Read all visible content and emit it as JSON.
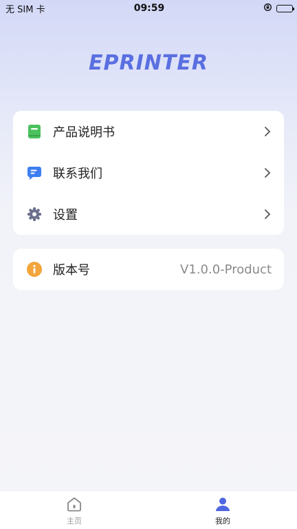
{
  "status_bar": {
    "carrier": "无 SIM 卡",
    "time": "09:59"
  },
  "app": {
    "logo_text": "EPRINTER",
    "accent_color": "#5a6fe0"
  },
  "menu": {
    "items": [
      {
        "label": "产品说明书",
        "icon": "book-icon"
      },
      {
        "label": "联系我们",
        "icon": "chat-icon"
      },
      {
        "label": "设置",
        "icon": "gear-icon"
      }
    ]
  },
  "version": {
    "label": "版本号",
    "value": "V1.0.0-Product",
    "icon": "info-icon"
  },
  "tab_bar": {
    "tabs": [
      {
        "label": "主页",
        "icon": "home-icon",
        "active": false
      },
      {
        "label": "我的",
        "icon": "user-icon",
        "active": true
      }
    ]
  }
}
